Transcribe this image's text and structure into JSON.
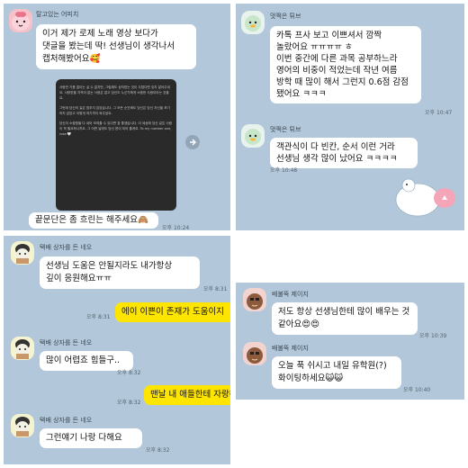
{
  "p1": {
    "sender": "탈고있는 어피치",
    "bubble1": "이거 제가 로제 노래 영상 보다가\n댓글을 봤는데 딱! 선생님이 생각나서\n캡처해봤어요🥰",
    "image_text_1": "사랑만 거품 없이는 살 수 없지만, 그럼에도 상처받는 것이 두렵다면 잊지 말아주세요. 사랑받을 자격이 없는 사람은 없고 당신도 누군가에게 소중한 사람이라는 것을요.",
    "image_text_2": "그런데 당신의 길은 멈추지 않았습니다. 그 모든 순간에도 당신은 당신 자신을 포기하지 않았고 이렇게 여기까지 와주었죠.",
    "image_text_3": "당신이 소중함을 다 내어 보여줄 수 있다면 참 좋겠습니다. 이 세상에 당신 같은 사람이 꼭 필요하니까요. 그 어떤 날에도 당신 편이 되어 줄게요. To my number one, rose 🤍",
    "bubble2": "끝문단은 좀 흐린는 해주세요🙈",
    "time2": "오후 10:24"
  },
  "p2": {
    "sender1": "멋쩍은 튀브",
    "bubble1": "카톡 프사 보고 이쁘셔서 깜짝\n놀랐어요 ㅠㅠㅠㅠ ㅎ\n이번 중간에 다른 과목 공부하느라\n영어의 비중이 적었는데 작년 여름\n방학 때 많이 해서 그런지 0.6점 감점\n됐어요 ㅋㅋㅋ",
    "time1": "오후 10:47",
    "sender2": "멋쩍은 튀브",
    "bubble2": "객관식이 다 빈칸, 순서 이런 거라\n선생님 생각 많이 났어요 ㅋㅋㅋㅋ",
    "time2": "오후 10:48"
  },
  "p3": {
    "sender1": "택배 상자를 든 네오",
    "bubble1": "선생님 도움은 안될지라도 내가항상\n깊이 응원해요ㅠㅠ",
    "time1": "오후 8:31",
    "mine1": "에이 이쁜이 존재가 도움이지",
    "time_mine1": "오후 8:31",
    "sender2": "택배 상자를 든 네오",
    "bubble2": "많이 어렵죠 힘들구..",
    "time2": "오후 8:32",
    "mine2": "맨날 내 애들한테 자랑해",
    "time_mine2": "오후 8:32",
    "sender3": "택배 상자를 든 네오",
    "bubble3": "그런얘기 나랑 다해요",
    "time3": "오후 8:32"
  },
  "p5": {
    "sender1": "배불뚝 제이지",
    "bubble1": "저도 항상 선생님한테 많이 배우는 것\n같아요😍😍",
    "time1": "오후 10:39",
    "sender2": "배불뚝 제이지",
    "bubble2": "오늘 푹 쉬시고 내일 유학원(?)\n화이팅하세요😺😺",
    "time2": "오후 10:40"
  },
  "colors": {
    "chat_bg": "#b2c7d9",
    "bubble_mine": "#fee500",
    "bubble_other": "#ffffff"
  }
}
